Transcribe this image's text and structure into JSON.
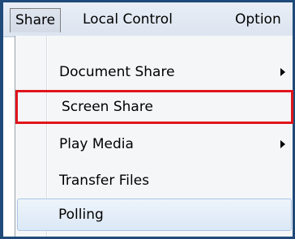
{
  "menubar": {
    "items": [
      {
        "label": "Share"
      },
      {
        "label": "Local Control"
      },
      {
        "label": "Option"
      }
    ]
  },
  "dropdown": {
    "items": [
      {
        "label": "Document Share",
        "submenu": true
      },
      {
        "label": "Screen Share",
        "submenu": false,
        "highlighted_red": true
      },
      {
        "label": "Play Media",
        "submenu": true
      },
      {
        "label": "Transfer Files",
        "submenu": false
      },
      {
        "label": "Polling",
        "submenu": false,
        "hovered": true
      }
    ]
  },
  "colors": {
    "frame_border": "#1f4a7a",
    "highlight_red": "#e0151b",
    "hover_blue": "#dbe8f6"
  }
}
